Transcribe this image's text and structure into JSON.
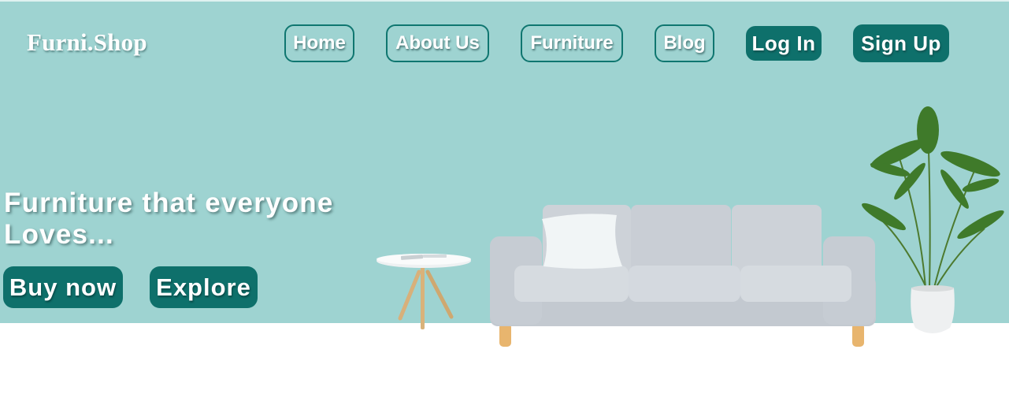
{
  "brand": {
    "name": "Furni.Shop"
  },
  "nav": {
    "home": "Home",
    "about": "About Us",
    "furniture": "Furniture",
    "blog": "Blog",
    "login": "Log In",
    "signup": "Sign Up"
  },
  "hero": {
    "tagline_line1": "Furniture that everyone",
    "tagline_line2": "Loves...",
    "buy_now": "Buy now",
    "explore": "Explore"
  },
  "colors": {
    "hero_background": "#9ed3d1",
    "accent": "#0e706b",
    "text": "#ffffff"
  },
  "illustrations": [
    "side-table",
    "grey-sofa",
    "potted-plant"
  ]
}
